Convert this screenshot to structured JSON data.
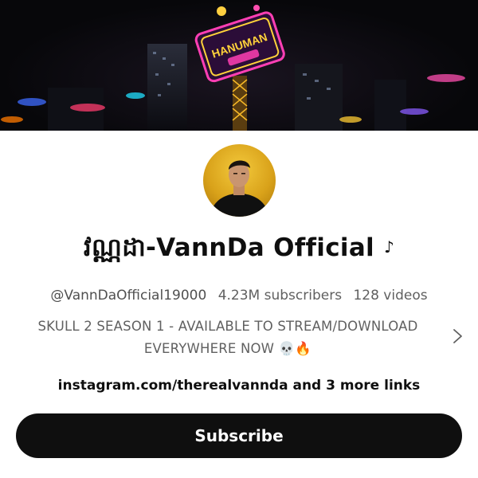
{
  "banner": {
    "image": "neon-city-banner",
    "sign_text": "HANUMAN"
  },
  "channel": {
    "avatar": "profile-photo",
    "name": "វណ្ណដា-VannDa Official",
    "name_icon": "music-note-icon",
    "handle": "@VannDaOfficial19000",
    "subscribers": "4.23M subscribers",
    "videos": "128 videos",
    "description_line1": "SKULL 2 SEASON 1 - AVAILABLE TO STREAM/DOWNLOAD",
    "description_line2": "EVERYWHERE NOW 💀🔥",
    "links": "instagram.com/therealvannda and 3 more links",
    "subscribe_label": "Subscribe"
  }
}
